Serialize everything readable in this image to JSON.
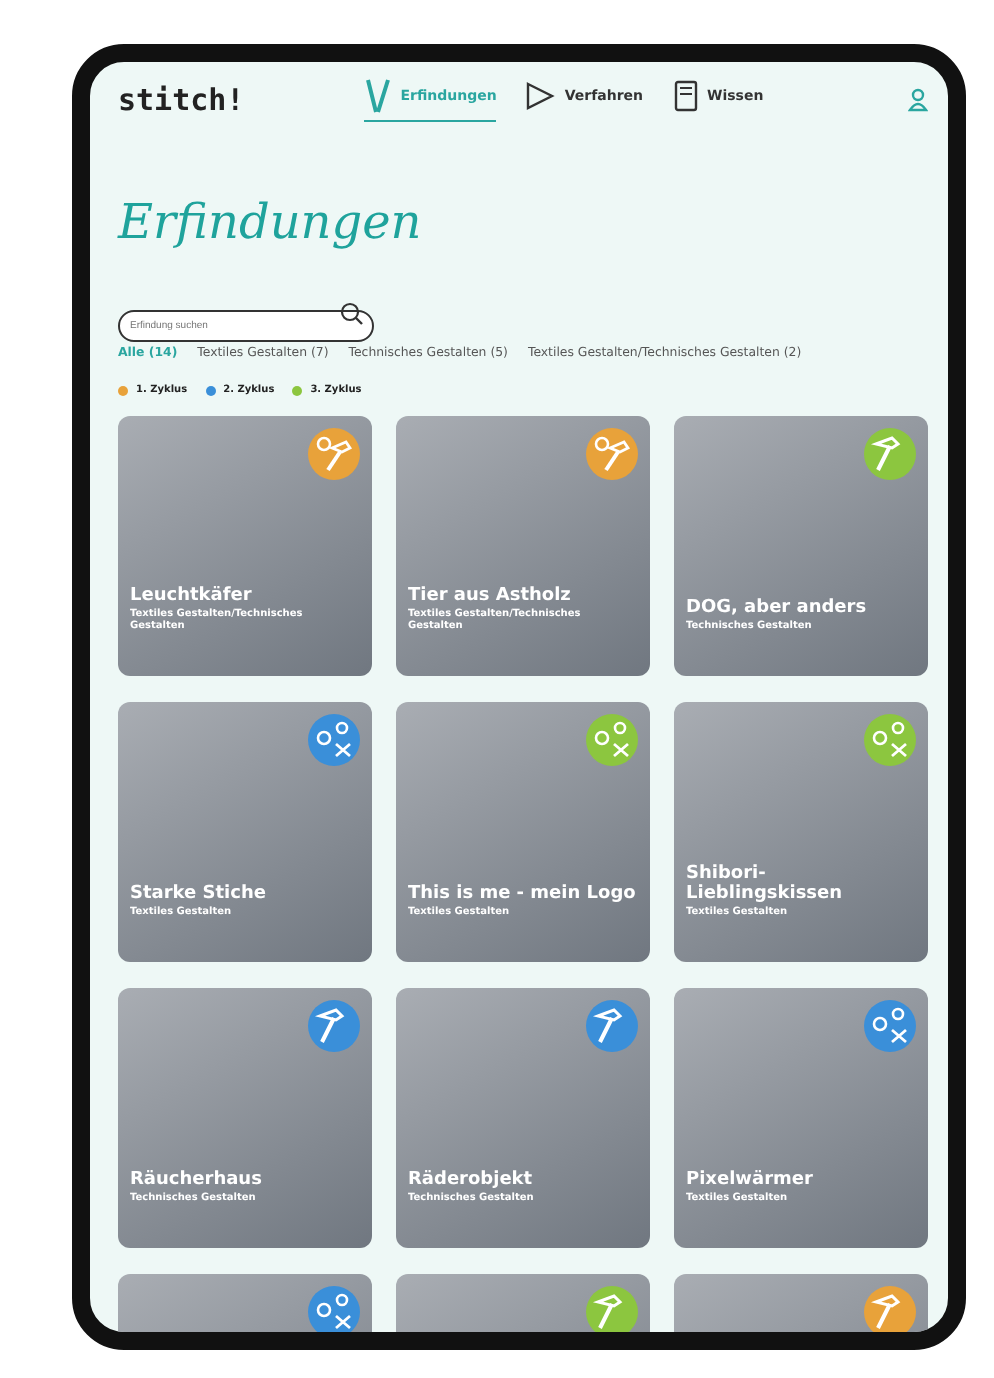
{
  "header": {
    "logo": "stitch!",
    "nav": [
      {
        "label": "Erfindungen",
        "selected": true
      },
      {
        "label": "Verfahren",
        "selected": false
      },
      {
        "label": "Wissen",
        "selected": false
      }
    ]
  },
  "title": "Erfindungen",
  "search": {
    "placeholder": "Erfindung suchen"
  },
  "filters": [
    {
      "label": "Alle (14)",
      "selected": true
    },
    {
      "label": "Textiles Gestalten (7)",
      "selected": false
    },
    {
      "label": "Technisches Gestalten (5)",
      "selected": false
    },
    {
      "label": "Textiles Gestalten/Technisches Gestalten (2)",
      "selected": false
    }
  ],
  "legend": [
    {
      "label": "1. Zyklus",
      "color": "#e8a23a"
    },
    {
      "label": "2. Zyklus",
      "color": "#3a8fd9"
    },
    {
      "label": "3. Zyklus",
      "color": "#8cc63f"
    }
  ],
  "cards": [
    {
      "title": "Leuchtkäfer",
      "subtitle": "Textiles Gestalten/Technisches Gestalten",
      "color": "#e8a23a",
      "kind": "mixed"
    },
    {
      "title": "Tier aus Astholz",
      "subtitle": "Textiles Gestalten/Technisches Gestalten",
      "color": "#e8a23a",
      "kind": "mixed"
    },
    {
      "title": "DOG, aber anders",
      "subtitle": "Technisches Gestalten",
      "color": "#8cc63f",
      "kind": "hammer"
    },
    {
      "title": "Starke Stiche",
      "subtitle": "Textiles Gestalten",
      "color": "#3a8fd9",
      "kind": "textile"
    },
    {
      "title": "This is me - mein Logo",
      "subtitle": "Textiles Gestalten",
      "color": "#8cc63f",
      "kind": "textile"
    },
    {
      "title": "Shibori-Lieblingskissen",
      "subtitle": "Textiles Gestalten",
      "color": "#8cc63f",
      "kind": "textile"
    },
    {
      "title": "Räucherhaus",
      "subtitle": "Technisches Gestalten",
      "color": "#3a8fd9",
      "kind": "hammer"
    },
    {
      "title": "Räderobjekt",
      "subtitle": "Technisches Gestalten",
      "color": "#3a8fd9",
      "kind": "hammer"
    },
    {
      "title": "Pixelwärmer",
      "subtitle": "Textiles Gestalten",
      "color": "#3a8fd9",
      "kind": "textile"
    },
    {
      "color": "#3a8fd9",
      "kind": "textile"
    },
    {
      "color": "#8cc63f",
      "kind": "hammer"
    },
    {
      "color": "#e8a23a",
      "kind": "hammer"
    }
  ]
}
